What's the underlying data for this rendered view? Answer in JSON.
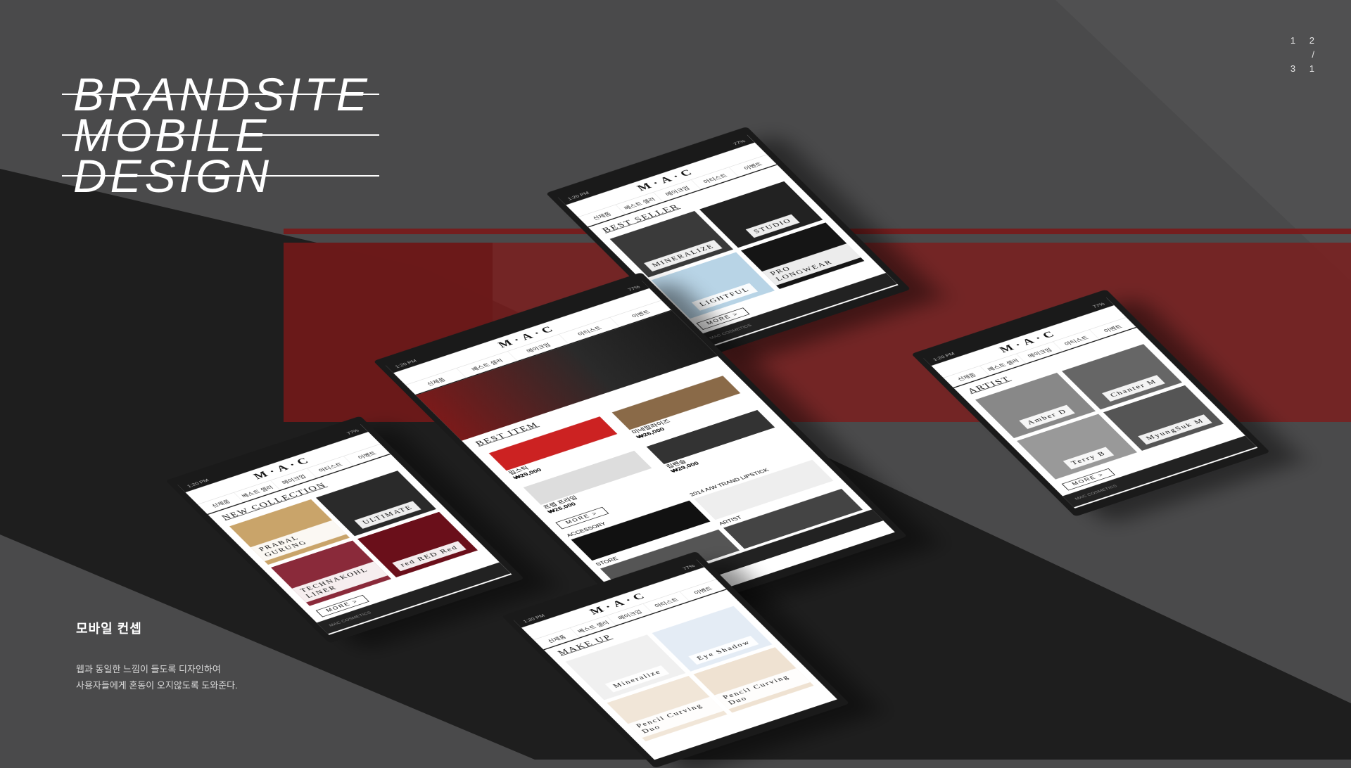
{
  "title_lines": [
    "BRANDSITE",
    "MOBILE",
    "DESIGN"
  ],
  "pager": {
    "current": "1 2",
    "sep": "/",
    "total": "3 1"
  },
  "concept": {
    "heading": "모바일 컨셉",
    "line1": "웹과 동일한 느낌이 들도록 디자인하여",
    "line2": "사용자들에게 혼동이 오지않도록 도와준다."
  },
  "phone": {
    "status_time": "1:20 PM",
    "status_battery": "77%",
    "brand": "M·A·C",
    "tabs": [
      "신제품",
      "베스트 셀러",
      "메이크업",
      "아티스트",
      "이벤트"
    ],
    "more": "MORE >",
    "footer": "MAC COSMETICS"
  },
  "screens": {
    "best_seller": {
      "section": "BEST SELLER",
      "tiles": [
        "MINERALIZE",
        "STUDIO",
        "LIGHTFUL",
        "PRO LONGWEAR"
      ]
    },
    "home": {
      "section": "BEST ITEM",
      "products": [
        {
          "name": "립스틱",
          "price": "₩29,000"
        },
        {
          "name": "미네랄라이즈",
          "price": "₩26,000"
        },
        {
          "name": "프렙 프라임",
          "price": "₩26,000"
        },
        {
          "name": "립펜슬",
          "price": "₩29,000"
        }
      ],
      "accessory": "ACCESSORY",
      "limited": "2014 A/W TRAND LIPSTICK",
      "store": "STORE",
      "artist": "ARTIST"
    },
    "artist": {
      "section": "ARTIST",
      "names": [
        "Amber D",
        "Chanter M",
        "Terry B",
        "MyungSuk M"
      ]
    },
    "new_collection": {
      "section": "NEW COLLECTION",
      "tiles": [
        "PRABAL GURUNG",
        "ULTIMATE",
        "TECHNAKOHL LINER",
        "red RED Red"
      ]
    },
    "makeup": {
      "section": "MAKE UP",
      "items": [
        "Mineralize",
        "Eye Shadow",
        "Pencil Curving Duo",
        "Pencil Curving Duo"
      ]
    }
  },
  "colors": {
    "background": "#4a4a4b",
    "dark_band": "#1e1e1e",
    "accent_red": "#7a1a1a",
    "phone_frame": "#1a1a1a"
  }
}
